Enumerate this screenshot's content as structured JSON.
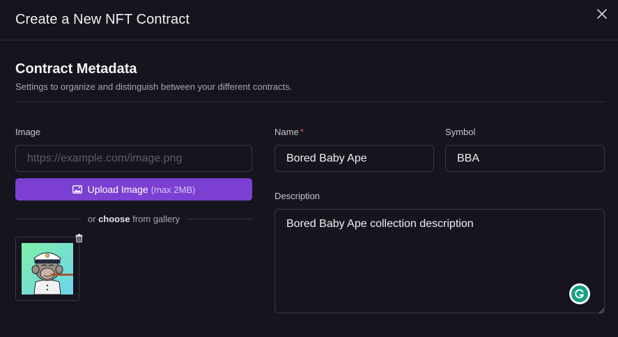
{
  "modal": {
    "title": "Create a New NFT Contract"
  },
  "section": {
    "title": "Contract Metadata",
    "subtitle": "Settings to organize and distinguish between your different contracts."
  },
  "image": {
    "label": "Image",
    "placeholder": "https://example.com/image.png",
    "upload_label": "Upload Image",
    "upload_hint": "(max 2MB)",
    "gallery_prefix": "or",
    "gallery_choose": "choose",
    "gallery_suffix": "from gallery"
  },
  "name": {
    "label": "Name",
    "required_mark": "*",
    "value": "Bored Baby Ape"
  },
  "symbol": {
    "label": "Symbol",
    "value": "BBA"
  },
  "description": {
    "label": "Description",
    "value": "Bored Baby Ape collection description"
  },
  "colors": {
    "background": "#16141c",
    "accent": "#7b3fd1",
    "required": "#e0546a",
    "grammarly": "#15a085"
  },
  "icons": [
    "close-icon",
    "image-icon",
    "trash-icon",
    "grammarly-icon",
    "resize-handle-icon"
  ]
}
